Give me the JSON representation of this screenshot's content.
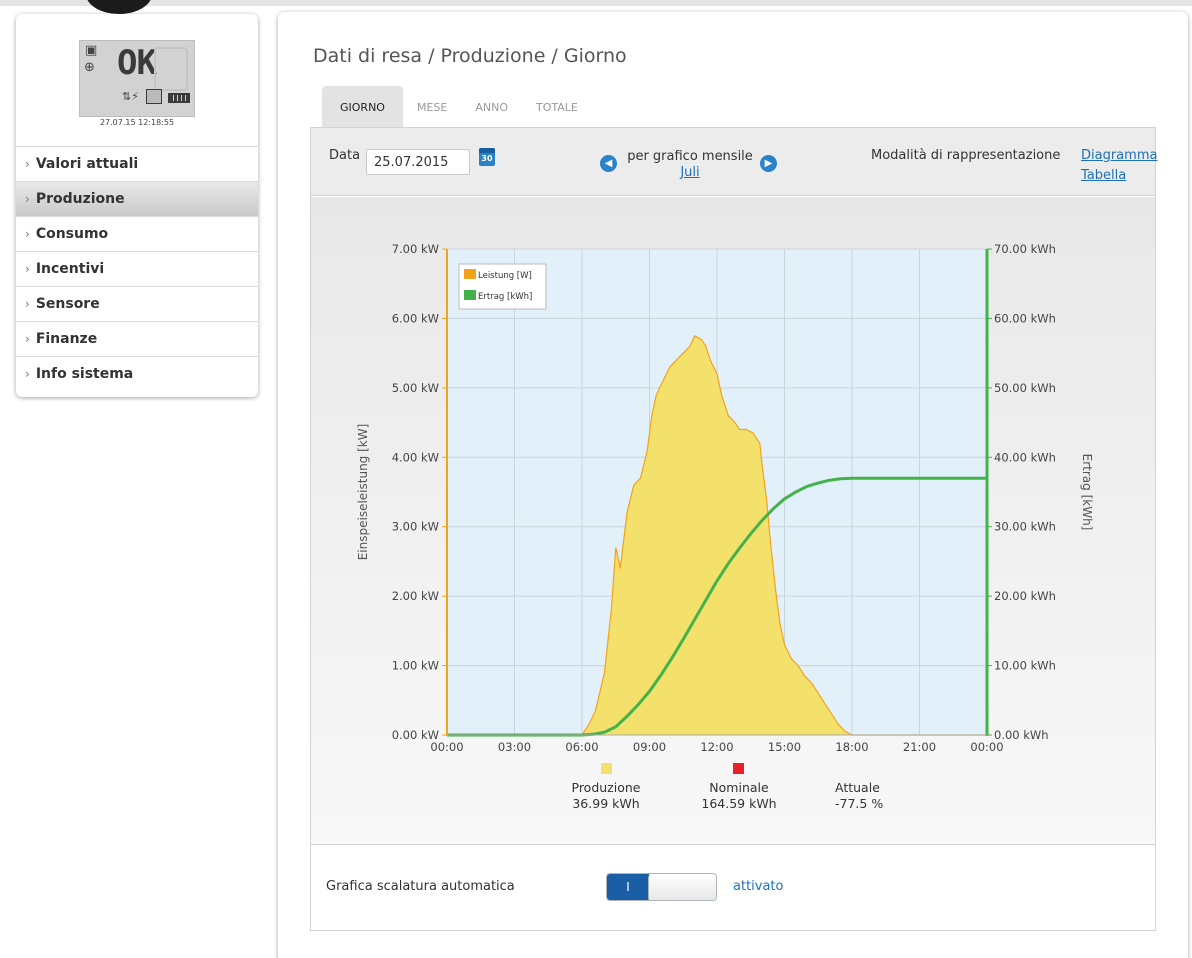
{
  "device": {
    "display_text": "OK",
    "timestamp": "27.07.15 12:18:55"
  },
  "sidebar": {
    "items": [
      {
        "label": "Valori attuali",
        "active": false
      },
      {
        "label": "Produzione",
        "active": true
      },
      {
        "label": "Consumo",
        "active": false
      },
      {
        "label": "Incentivi",
        "active": false
      },
      {
        "label": "Sensore",
        "active": false
      },
      {
        "label": "Finanze",
        "active": false
      },
      {
        "label": "Info sistema",
        "active": false
      }
    ]
  },
  "page": {
    "title": "Dati di resa / Produzione / Giorno",
    "tabs": [
      {
        "label": "GIORNO",
        "active": true
      },
      {
        "label": "MESE",
        "active": false
      },
      {
        "label": "ANNO",
        "active": false
      },
      {
        "label": "TOTALE",
        "active": false
      }
    ]
  },
  "filter": {
    "date_label": "Data",
    "date_value": "25.07.2015",
    "calendar_icon_text": "30",
    "monthly_label": "per grafico mensile",
    "monthly_link": "Juli",
    "mode_label": "Modalità di rappresentazione",
    "mode_diagram": "Diagramma",
    "mode_table": "Tabella"
  },
  "summary": {
    "production_label": "Produzione",
    "production_value": "36.99 kWh",
    "nominal_label": "Nominale",
    "nominal_value": "164.59 kWh",
    "current_label": "Attuale",
    "current_value": "-77.5 %"
  },
  "settings": {
    "auto_scale_label": "Grafica scalatura automatica",
    "toggle_on_text": "I",
    "toggle_state_text": "attivato"
  },
  "colors": {
    "power_fill": "#f3e16c",
    "power_line": "#f3a21b",
    "energy_line": "#44b24b",
    "plot_bg": "#e2f0fa",
    "nominal": "#e8202a",
    "link": "#1d70b8"
  },
  "chart_data": {
    "type": "area",
    "ylabel": "Einspeiseleistung [kW]",
    "y2label": "Ertrag [kWh]",
    "ylim": [
      0,
      7
    ],
    "y2lim": [
      0,
      70
    ],
    "y_ticks": [
      "0.00 kW",
      "1.00 kW",
      "2.00 kW",
      "3.00 kW",
      "4.00 kW",
      "5.00 kW",
      "6.00 kW",
      "7.00 kW"
    ],
    "y2_ticks": [
      "0.00 kWh",
      "10.00 kWh",
      "20.00 kWh",
      "30.00 kWh",
      "40.00 kWh",
      "50.00 kWh",
      "60.00 kWh",
      "70.00 kWh"
    ],
    "x_ticks": [
      "00:00",
      "03:00",
      "06:00",
      "09:00",
      "12:00",
      "15:00",
      "18:00",
      "21:00",
      "00:00"
    ],
    "xlim_hours": [
      0,
      24
    ],
    "legend": "top-left",
    "grid": true,
    "series": [
      {
        "name": "Leistung [W]",
        "axis": "left",
        "x_hours": [
          0,
          6,
          6.3,
          6.6,
          7.0,
          7.3,
          7.5,
          7.7,
          8.0,
          8.3,
          8.6,
          8.9,
          9.1,
          9.3,
          9.6,
          9.9,
          10.2,
          10.5,
          10.8,
          11.0,
          11.3,
          11.5,
          11.7,
          12.0,
          12.2,
          12.5,
          12.8,
          13.0,
          13.3,
          13.6,
          13.9,
          14.0,
          14.2,
          14.4,
          14.6,
          14.8,
          15.0,
          15.3,
          15.6,
          15.9,
          16.2,
          16.5,
          16.8,
          17.1,
          17.4,
          17.7,
          18.0,
          24
        ],
        "values": [
          0,
          0,
          0.15,
          0.35,
          0.9,
          1.8,
          2.7,
          2.4,
          3.2,
          3.6,
          3.7,
          4.1,
          4.6,
          4.9,
          5.1,
          5.3,
          5.4,
          5.5,
          5.6,
          5.75,
          5.7,
          5.6,
          5.4,
          5.2,
          4.9,
          4.6,
          4.5,
          4.4,
          4.4,
          4.35,
          4.2,
          3.9,
          3.4,
          2.7,
          2.1,
          1.6,
          1.3,
          1.1,
          1.0,
          0.85,
          0.75,
          0.6,
          0.45,
          0.3,
          0.15,
          0.05,
          0,
          0
        ]
      },
      {
        "name": "Ertrag [kWh]",
        "axis": "right",
        "x_hours": [
          0,
          6,
          6.5,
          7,
          7.5,
          8,
          8.5,
          9,
          9.5,
          10,
          10.5,
          11,
          11.5,
          12,
          12.5,
          13,
          13.5,
          14,
          14.5,
          15,
          15.5,
          16,
          16.5,
          17,
          17.5,
          18,
          24
        ],
        "values": [
          0,
          0,
          0.1,
          0.4,
          1.2,
          2.7,
          4.4,
          6.3,
          8.6,
          11.1,
          13.8,
          16.6,
          19.4,
          22.2,
          24.7,
          26.9,
          29.0,
          30.9,
          32.6,
          34.0,
          35.0,
          35.8,
          36.3,
          36.7,
          36.9,
          36.99,
          36.99
        ]
      }
    ]
  }
}
